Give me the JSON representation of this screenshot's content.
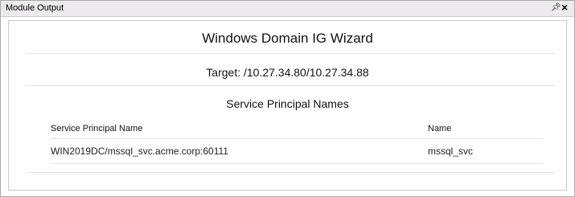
{
  "window": {
    "title": "Module Output",
    "pin_icon": "pin-icon",
    "close_icon": "close-icon"
  },
  "report": {
    "title": "Windows Domain IG Wizard",
    "target": "Target: /10.27.34.80/10.27.34.88",
    "section_title": "Service Principal Names"
  },
  "table": {
    "columns": [
      "Service Principal Name",
      "Name"
    ],
    "rows": [
      [
        "WIN2019DC/mssql_svc.acme.corp:60111",
        "mssql_svc"
      ]
    ]
  }
}
